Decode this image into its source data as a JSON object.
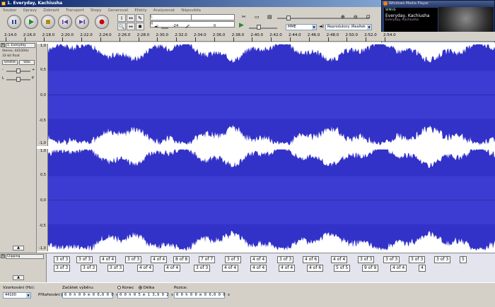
{
  "window": {
    "title": "1. Everyday, Kachiusha"
  },
  "menu": [
    "Soubor",
    "Úpravy",
    "Zobrazit",
    "Transport",
    "Stopy",
    "Generovat",
    "Efekty",
    "Analyzovat",
    "Nápověda"
  ],
  "toolbar": {
    "transport": [
      "pause",
      "play",
      "stop",
      "skip-start",
      "skip-end",
      "record"
    ],
    "tools": [
      "I",
      "↔",
      "✎",
      "🔍",
      "↔",
      "✱"
    ],
    "meter_left": "L",
    "meter_right": "R",
    "meter_db_left": "-24",
    "meter_db_right": "0",
    "host": "MME",
    "output_device": "Reprodukory (Realtek"
  },
  "wmp": {
    "title": "Windows Media Player",
    "status": "WMHS",
    "song": "Everyday, Kachiusha",
    "artist": "Everyday, Kachiusha"
  },
  "ruler": {
    "ticks": [
      "2:14.0",
      "2:16.0",
      "2:18.0",
      "2:20.0",
      "2:22.0",
      "2:24.0",
      "2:26.0",
      "2:28.0",
      "2:30.0",
      "2:32.0",
      "2:34.0",
      "2:36.0",
      "2:38.0",
      "2:40.0",
      "2:42.0",
      "2:44.0",
      "2:46.0",
      "2:48.0",
      "2:50.0",
      "2:52.0",
      "2:54.0"
    ]
  },
  "track": {
    "name": "1. Everyday",
    "rate": "Stereo, 44100Hz",
    "format": "32-bit float",
    "mute": "Umlčet",
    "solo": "Sólo",
    "gain_l": "-",
    "gain_r": "+",
    "pan_l": "L",
    "pan_r": "P",
    "scale": [
      "1,0",
      "0,5",
      "0,0",
      "-0,5",
      "-1,0"
    ],
    "wave_color": "#3232c8"
  },
  "label_track": {
    "name": "Clipping",
    "row1": [
      "3 of 3",
      "3 of 3",
      "4 of 4",
      "3 of 3",
      "4 of 4",
      "8 of 8",
      "7 of 7",
      "3 of 3",
      "4 of 4",
      "3 of 3",
      "4 of 6",
      "4 of 4",
      "3 of 3",
      "3 of 3",
      "3 of 3",
      "3 of 3",
      "5"
    ],
    "row2": [
      "3 of 3",
      "3 of 3",
      "3 of 3",
      "4 of 4",
      "4 of 4",
      "3 of 3",
      "4 of 4",
      "4 of 4",
      "4 of 4",
      "4 of 6",
      "5 of 5",
      "9 of 9",
      "4 of 4",
      "4"
    ]
  },
  "selection_bar": {
    "rate_label": "Vzorkování (Hz):",
    "rate_value": "44100",
    "start_label": "Začátek výběru:",
    "snap_label": "Přitahování",
    "end_label": "Konec",
    "length_label": "Délka",
    "pos_label": "Pozice:",
    "start_value": "0 0 h 0 0 m 0 0,0 0 0 s",
    "length_value": "0 0 h 0 5 m 1 3,9 9 2 s",
    "pos_value": "0 0 h 0 0 m 0 0,0 0 0 s"
  }
}
